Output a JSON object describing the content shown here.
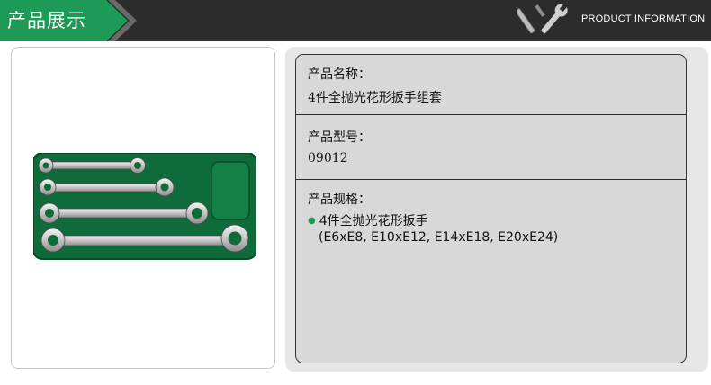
{
  "header": {
    "title": "产品展示",
    "info_label": "PRODUCT INFORMATION",
    "tools_icon": "wrench-screwdriver-icon"
  },
  "image": {
    "alt": "4件全抛光花形扳手组套",
    "tray_color": "#0f6b3a"
  },
  "info": {
    "name_label": "产品名称：",
    "name_value": "4件全抛光花形扳手组套",
    "model_label": "产品型号：",
    "model_value": "09012",
    "spec_label": "产品规格：",
    "spec_line1": "4件全抛光花形扳手",
    "spec_line2": "(E6xE8, E10xE12, E14xE18, E20xE24)"
  },
  "colors": {
    "accent": "#1d9a56",
    "header_bg": "#2c2c2c",
    "panel_bg": "#d8d8d8"
  }
}
